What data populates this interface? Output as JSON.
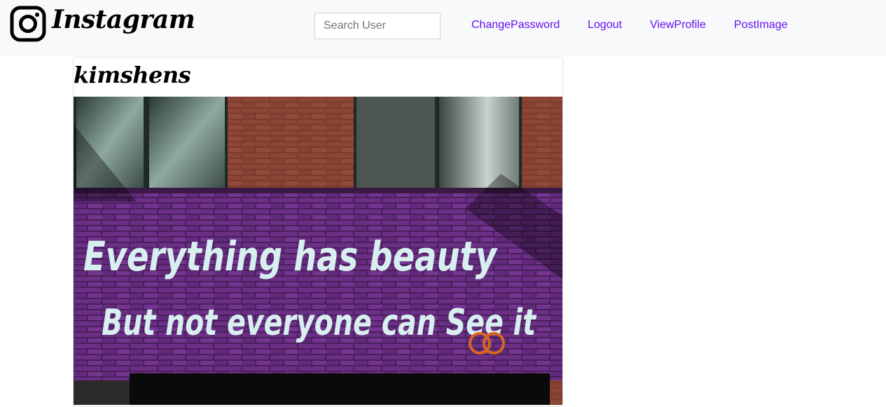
{
  "navbar": {
    "brand": "Instagram",
    "search_placeholder": "Search User",
    "links": {
      "change_password": "ChangePassword",
      "logout": "Logout",
      "view_profile": "ViewProfile",
      "post_image": "PostImage"
    },
    "link_color": "#6610f2"
  },
  "post": {
    "username": "kimshens",
    "image_caption_line1": "Everything has beauty",
    "image_caption_line2": "But not everyone can See it"
  },
  "icons": {
    "logo": "instagram-camera-icon"
  }
}
